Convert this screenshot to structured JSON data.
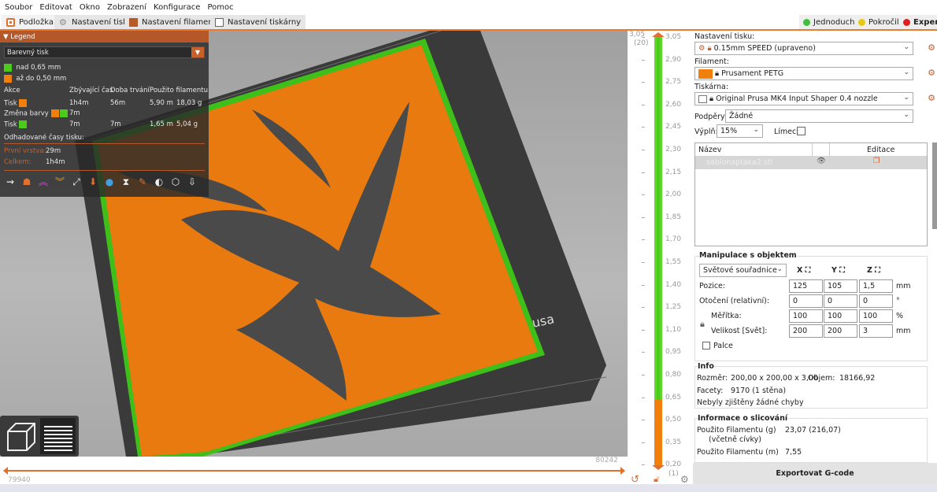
{
  "menu": [
    "Soubor",
    "Editovat",
    "Okno",
    "Zobrazení",
    "Konfigurace",
    "Pomoc"
  ],
  "tabs": [
    {
      "label": "Podložka",
      "icon": "bed-icon"
    },
    {
      "label": "Nastavení tisku",
      "icon": "gear-icon"
    },
    {
      "label": "Nastavení filamentu",
      "icon": "spool-icon"
    },
    {
      "label": "Nastavení tiskárny",
      "icon": "printer-icon"
    }
  ],
  "modes": [
    {
      "label": "Jednoduchý",
      "color": "#3fbf3f"
    },
    {
      "label": "Pokročilý",
      "color": "#e8c814"
    },
    {
      "label": "Expert",
      "color": "#e02020"
    }
  ],
  "legend": {
    "title": "Legend",
    "view_type": "Barevný tisk",
    "ranges": [
      {
        "label": "nad 0,65 mm",
        "color": "#4ccc1a"
      },
      {
        "label": "až do 0,50 mm",
        "color": "#f07f0c"
      }
    ],
    "headers": [
      "Akce",
      "Zbývající čas",
      "Doba trvání",
      "Použito filamentu"
    ],
    "rows": [
      {
        "action": "Tisk",
        "remaining": "1h4m",
        "duration": "56m",
        "length": "5,90 m",
        "weight": "18,03 g"
      },
      {
        "action": "Změna barvy",
        "remaining": "7m",
        "duration": "",
        "length": "",
        "weight": ""
      },
      {
        "action": "Tisk",
        "remaining": "7m",
        "duration": "7m",
        "length": "1,65 m",
        "weight": "5,04 g"
      }
    ],
    "estimated_label": "Odhadované časy tisku:",
    "first_layer_label": "První vrstva:",
    "first_layer": "29m",
    "total_label": "Celkem:",
    "total": "1h4m"
  },
  "viewport": {
    "bed_text": "usa"
  },
  "vslider": {
    "top_value": "3,05",
    "top_layer": "(20)",
    "bottom_value": "0,20",
    "bottom_layer": "(1)",
    "ticks": [
      "3,05",
      "2,90",
      "2,75",
      "2,60",
      "2,45",
      "2,30",
      "2,15",
      "2,00",
      "1,85",
      "1,70",
      "1,55",
      "1,40",
      "1,25",
      "1,10",
      "0,95",
      "0,80",
      "0,65",
      "0,50",
      "0,35",
      "0,20"
    ],
    "color_change_at": "0,65"
  },
  "hslider": {
    "left": "79940",
    "right": "80242"
  },
  "panel": {
    "print_settings_label": "Nastavení tisku:",
    "print_settings": "0.15mm SPEED (upraveno)",
    "filament_label": "Filament:",
    "filament": "Prusament PETG",
    "filament_color": "#f07f0c",
    "printer_label": "Tiskárna:",
    "printer": "Original Prusa MK4 Input Shaper 0.4 nozzle",
    "supports_label": "Podpěry:",
    "supports": "Žádné",
    "infill_label": "Výplň:",
    "infill": "15%",
    "brim_label": "Límec:",
    "objects": {
      "col_name": "Název",
      "col_edit": "Editace",
      "items": [
        "sablonaptaka2.stl"
      ]
    },
    "manip": {
      "title": "Manipulace s objektem",
      "coords": "Světové souřadnice",
      "axes": [
        "X",
        "Y",
        "Z"
      ],
      "rows": [
        {
          "label": "Pozice:",
          "values": [
            "125",
            "105",
            "1,5"
          ],
          "unit": "mm"
        },
        {
          "label": "Otočení (relativní):",
          "values": [
            "0",
            "0",
            "0"
          ],
          "unit": "°"
        },
        {
          "label": "Měřítka:",
          "values": [
            "100",
            "100",
            "100"
          ],
          "unit": "%"
        },
        {
          "label": "Velikost [Svět]:",
          "values": [
            "200",
            "200",
            "3"
          ],
          "unit": "mm"
        }
      ],
      "inches": "Palce"
    },
    "info": {
      "title": "Info",
      "size_label": "Rozměr:",
      "size": "200,00 x 200,00 x 3,00",
      "volume_label": "Objem:",
      "volume": "18166,92",
      "facets_label": "Facety:",
      "facets": "9170 (1 stěna)",
      "errors": "Nebyly zjištěny žádné chyby"
    },
    "slice": {
      "title": "Informace o slicování",
      "fil_g_label": "Použito Filamentu (g)",
      "fil_g_sub": "(včetně cívky)",
      "fil_g": "23,07 (216,07)",
      "fil_m_label": "Použito Filamentu (m)",
      "fil_m": "7,55"
    },
    "export": "Exportovat G-code"
  }
}
